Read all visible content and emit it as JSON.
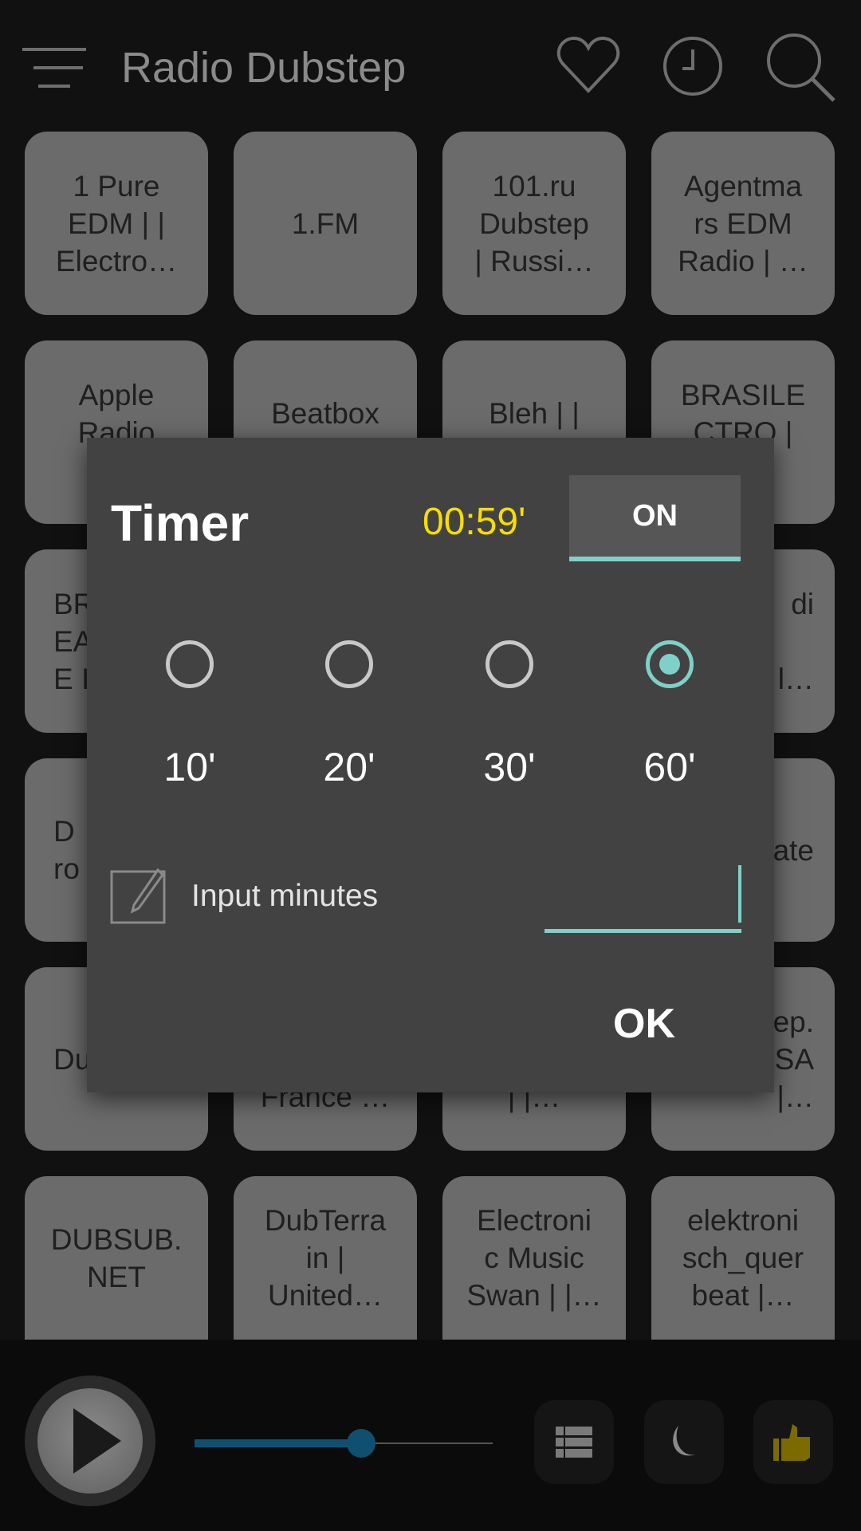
{
  "header": {
    "title": "Radio Dubstep",
    "icons": [
      "menu-icon",
      "heart-icon",
      "clock-icon",
      "search-icon"
    ]
  },
  "stations": [
    "1 Pure\nEDM | |\nElectro…",
    "1.FM",
    "101.ru\nDubstep\n| Russi…",
    "Agentma\nrs EDM\nRadio | …",
    "Apple\nRadio\nDa",
    "Beatbox\n|",
    "Bleh | |\nDubstep|",
    "BRASILE\nCTRO |\n|…",
    "BR\nEA\nE I",
    "",
    "",
    "di\n\nl…",
    "D\nro",
    "",
    "",
    "ate",
    "Du",
    "\n\nFrance …",
    "\n\n| |…",
    "ep.\nSA\n|…",
    "DUBSUB.\nNET",
    "DubTerra\nin |\nUnited…",
    "Electroni\nc Music\nSwan | |…",
    "elektroni\nsch_quer\nbeat |…"
  ],
  "dialog": {
    "title": "Timer",
    "remaining": "00:59'",
    "toggle_label": "ON",
    "options": [
      {
        "label": "10'",
        "selected": false
      },
      {
        "label": "20'",
        "selected": false
      },
      {
        "label": "30'",
        "selected": false
      },
      {
        "label": "60'",
        "selected": true
      }
    ],
    "input_label": "Input minutes",
    "input_value": "",
    "ok_label": "OK"
  },
  "player": {
    "volume": 0.56,
    "buttons": [
      "list-icon",
      "moon-icon",
      "thumbs-up-icon"
    ]
  },
  "colors": {
    "accent": "#7fd0c8",
    "timer": "#f7dd00",
    "slider": "#0f5070",
    "thumb": "#7a6a00"
  }
}
